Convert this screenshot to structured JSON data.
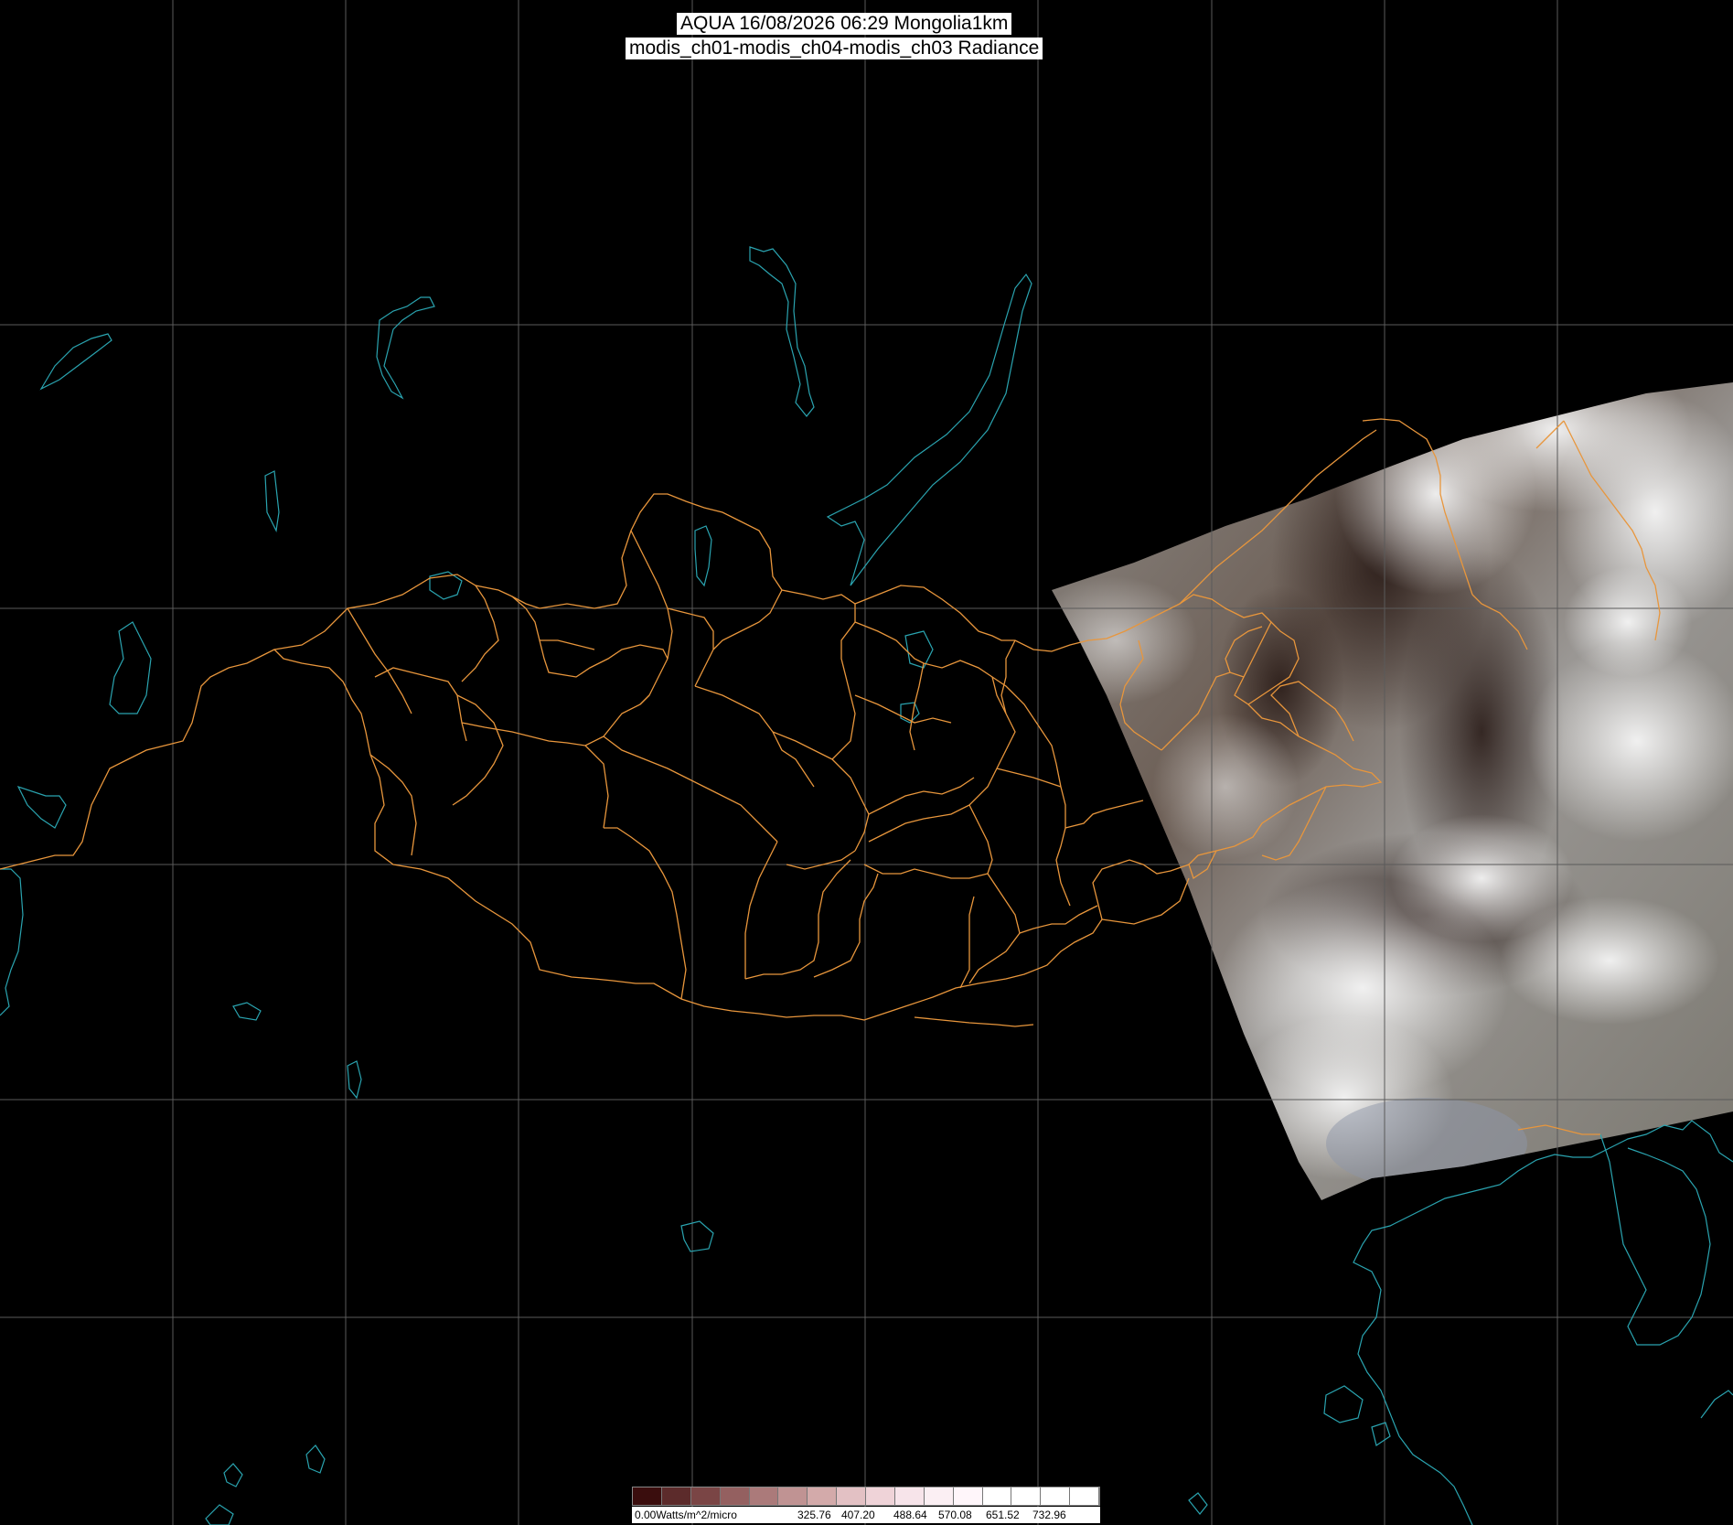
{
  "header": {
    "line1": "AQUA 16/08/2026 06:29 Mongolia1km",
    "line2": "modis_ch01-modis_ch04-modis_ch03 Radiance"
  },
  "colorbar": {
    "unit_label": "0.00Watts/m^2/micro",
    "tick_labels": [
      "325.76",
      "407.20",
      "488.64",
      "570.08",
      "651.52",
      "732.96"
    ],
    "colors": [
      "#3a0d0d",
      "#5c2b2b",
      "#7a4545",
      "#946060",
      "#ab7a7a",
      "#c09393",
      "#d3aaaa",
      "#e3c1c4",
      "#efd3d8",
      "#f7e4ea",
      "#fbeff3",
      "#fff6fa",
      "#ffffff",
      "#ffffff",
      "#ffffff",
      "#ffffff"
    ]
  },
  "colors": {
    "background": "#000000",
    "graticule": "#5a5a5a",
    "coastline": "#2aa4b0",
    "admin_boundary": "#e8963c"
  }
}
